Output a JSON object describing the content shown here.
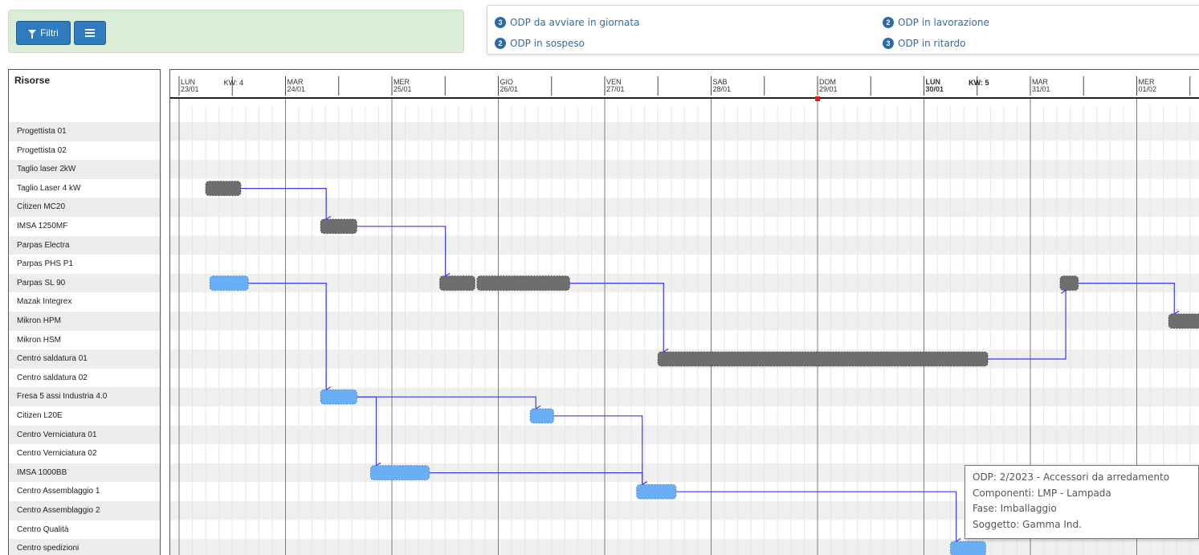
{
  "toolbar": {
    "filter_label": "Filtri",
    "filter_icon": "funnel-icon",
    "menu_icon": "hamburger-icon"
  },
  "summary": {
    "items": [
      {
        "count": "3",
        "label": "ODP da avviare in giornata"
      },
      {
        "count": "2",
        "label": "ODP in sospeso"
      },
      {
        "count": "2",
        "label": "ODP in lavorazione"
      },
      {
        "count": "3",
        "label": "ODP in ritardo"
      }
    ]
  },
  "resources": {
    "title": "Risorse",
    "items": [
      "Progettista 01",
      "Progettista 02",
      "Taglio laser 2kW",
      "Taglio Laser 4 kW",
      "Citizen MC20",
      "IMSA 1250MF",
      "Parpas Electra",
      "Parpas PHS P1",
      "Parpas SL 90",
      "Mazak Integrex",
      "Mikron HPM",
      "Mikron HSM",
      "Centro saldatura 01",
      "Centro saldatura 02",
      "Fresa 5 assi Industria 4.0",
      "Citizen L20E",
      "Centro Verniciatura 01",
      "Centro Verniciatura 02",
      "IMSA 1000BB",
      "Centro Assemblaggio 1",
      "Centro Assemblaggio 2",
      "Centro Qualità",
      "Centro spedizioni"
    ]
  },
  "timeline": {
    "days": [
      {
        "name": "LUN",
        "date": "23/01",
        "bold": false
      },
      {
        "name": "MAR",
        "date": "24/01",
        "bold": false
      },
      {
        "name": "MER",
        "date": "25/01",
        "bold": false
      },
      {
        "name": "GIO",
        "date": "26/01",
        "bold": false
      },
      {
        "name": "VEN",
        "date": "27/01",
        "bold": false
      },
      {
        "name": "SAB",
        "date": "28/01",
        "bold": false
      },
      {
        "name": "DOM",
        "date": "29/01",
        "bold": false
      },
      {
        "name": "LUN",
        "date": "30/01",
        "bold": true
      },
      {
        "name": "MAR",
        "date": "31/01",
        "bold": false
      },
      {
        "name": "MER",
        "date": "01/02",
        "bold": false
      }
    ],
    "weeks": [
      {
        "label": "KW: 4",
        "after_day": 0,
        "bold": false
      },
      {
        "label": "KW: 5",
        "after_day": 7,
        "bold": true
      }
    ],
    "today_day": 6
  },
  "gantt": {
    "colors": {
      "in_progress": "#6e6e6e",
      "planned": "#6aaef5",
      "link": "#3a3af0"
    },
    "tasks": [
      {
        "id": "t1",
        "resource": 3,
        "start": 0.25,
        "end": 0.58,
        "status": "in_progress"
      },
      {
        "id": "t2",
        "resource": 5,
        "start": 1.33,
        "end": 1.67,
        "status": "in_progress"
      },
      {
        "id": "t3",
        "resource": 8,
        "start": 2.45,
        "end": 2.78,
        "status": "in_progress"
      },
      {
        "id": "t4",
        "resource": 8,
        "start": 2.8,
        "end": 3.67,
        "status": "in_progress"
      },
      {
        "id": "t5",
        "resource": 12,
        "start": 4.5,
        "end": 7.6,
        "status": "in_progress"
      },
      {
        "id": "t6",
        "resource": 8,
        "start": 8.28,
        "end": 8.45,
        "status": "in_progress"
      },
      {
        "id": "t7",
        "resource": 10,
        "start": 9.3,
        "end": 9.7,
        "status": "in_progress"
      },
      {
        "id": "p1",
        "resource": 8,
        "start": 0.29,
        "end": 0.65,
        "status": "planned"
      },
      {
        "id": "p2",
        "resource": 14,
        "start": 1.33,
        "end": 1.67,
        "status": "planned"
      },
      {
        "id": "p3",
        "resource": 15,
        "start": 3.3,
        "end": 3.52,
        "status": "planned"
      },
      {
        "id": "p4",
        "resource": 18,
        "start": 1.8,
        "end": 2.35,
        "status": "planned"
      },
      {
        "id": "p5",
        "resource": 19,
        "start": 4.3,
        "end": 4.67,
        "status": "planned"
      },
      {
        "id": "p6",
        "resource": 22,
        "start": 7.25,
        "end": 7.58,
        "status": "planned"
      }
    ],
    "links": [
      [
        "t1",
        "t2"
      ],
      [
        "t2",
        "t3"
      ],
      [
        "t4",
        "t5"
      ],
      [
        "t5",
        "t6"
      ],
      [
        "t6",
        "t7"
      ],
      [
        "p1",
        "p2"
      ],
      [
        "p2",
        "p3"
      ],
      [
        "p2",
        "p4"
      ],
      [
        "p3",
        "p5"
      ],
      [
        "p4",
        "p5"
      ],
      [
        "p5",
        "p6"
      ]
    ]
  },
  "tooltip": {
    "lines": [
      "ODP: 2/2023 - Accessori da arredamento",
      "Componenti: LMP - Lampada",
      "Fase: Imballaggio",
      "Soggetto: Gamma Ind."
    ]
  }
}
